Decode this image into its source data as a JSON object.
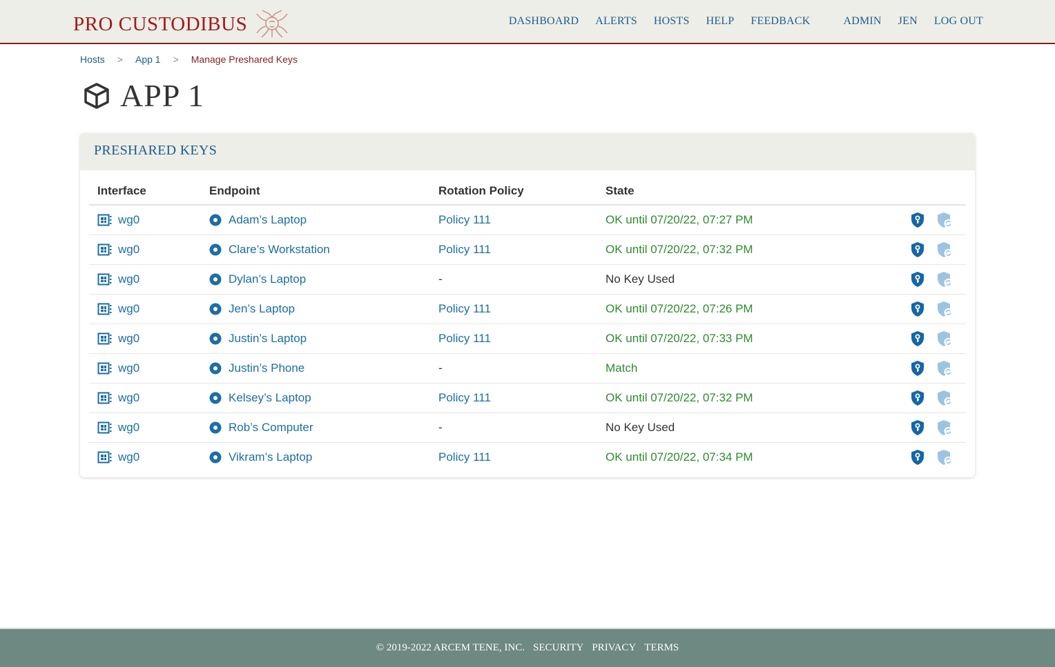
{
  "brand": {
    "name": "PRO CUSTODIBUS"
  },
  "nav": {
    "dashboard": "DASHBOARD",
    "alerts": "ALERTS",
    "hosts": "HOSTS",
    "help": "HELP",
    "feedback": "FEEDBACK",
    "admin": "ADMIN",
    "user": "JEN",
    "logout": "LOG OUT"
  },
  "breadcrumb": {
    "hosts": "Hosts",
    "sep1": ">",
    "app": "App 1",
    "sep2": ">",
    "current": "Manage Preshared Keys"
  },
  "page": {
    "title": "APP 1"
  },
  "card": {
    "title": "PRESHARED KEYS"
  },
  "table": {
    "headers": {
      "interface": "Interface",
      "endpoint": "Endpoint",
      "rotation_policy": "Rotation Policy",
      "state": "State"
    },
    "rows": [
      {
        "interface": "wg0",
        "endpoint": "Adam’s Laptop",
        "policy": "Policy 111",
        "state": "OK until 07/20/22, 07:27 PM",
        "state_type": "ok"
      },
      {
        "interface": "wg0",
        "endpoint": "Clare’s Workstation",
        "policy": "Policy 111",
        "state": "OK until 07/20/22, 07:32 PM",
        "state_type": "ok"
      },
      {
        "interface": "wg0",
        "endpoint": "Dylan’s Laptop",
        "policy": "-",
        "state": "No Key Used",
        "state_type": "plain"
      },
      {
        "interface": "wg0",
        "endpoint": "Jen’s Laptop",
        "policy": "Policy 111",
        "state": "OK until 07/20/22, 07:26 PM",
        "state_type": "ok"
      },
      {
        "interface": "wg0",
        "endpoint": "Justin’s Laptop",
        "policy": "Policy 111",
        "state": "OK until 07/20/22, 07:33 PM",
        "state_type": "ok"
      },
      {
        "interface": "wg0",
        "endpoint": "Justin’s Phone",
        "policy": "-",
        "state": "Match",
        "state_type": "ok"
      },
      {
        "interface": "wg0",
        "endpoint": "Kelsey’s Laptop",
        "policy": "Policy 111",
        "state": "OK until 07/20/22, 07:32 PM",
        "state_type": "ok"
      },
      {
        "interface": "wg0",
        "endpoint": "Rob’s Computer",
        "policy": "-",
        "state": "No Key Used",
        "state_type": "plain"
      },
      {
        "interface": "wg0",
        "endpoint": "Vikram’s Laptop",
        "policy": "Policy 111",
        "state": "OK until 07/20/22, 07:34 PM",
        "state_type": "ok"
      }
    ]
  },
  "footer": {
    "copyright": "© 2019-2022 ARCEM TENE, INC.",
    "security": "SECURITY",
    "privacy": "PRIVACY",
    "terms": "TERMS"
  },
  "colors": {
    "brand": "#a11b1b",
    "link": "#1c6ea4",
    "ok": "#2e8b2e",
    "header_bg": "#eeeee8",
    "footer_bg": "#6e8882"
  },
  "icons": {
    "brand_logo": "medusa-logo-icon",
    "page_title": "cube-icon",
    "interface": "interface-icon",
    "endpoint": "endpoint-dot-icon",
    "set_key": "shield-key-icon",
    "rotate_key": "shield-rotate-icon"
  }
}
